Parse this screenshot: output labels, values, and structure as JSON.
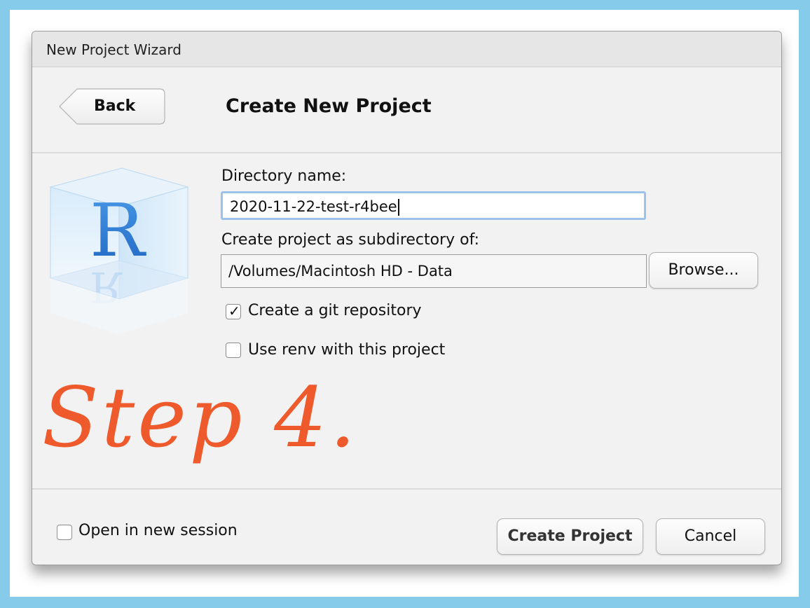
{
  "window": {
    "title": "New Project Wizard"
  },
  "header": {
    "back_label": "Back",
    "title": "Create New Project"
  },
  "form": {
    "directory_name_label": "Directory name:",
    "directory_name_value": "2020-11-22-test-r4bee",
    "parent_label": "Create project as subdirectory of:",
    "parent_value": "/Volumes/Macintosh HD - Data",
    "browse_label": "Browse...",
    "git_label": "Create a git repository",
    "git_checked": true,
    "renv_label": "Use renv with this project",
    "renv_checked": false
  },
  "annotation": {
    "text": "Step 4.",
    "color": "#EE5A2C"
  },
  "footer": {
    "new_session_label": "Open in new session",
    "new_session_checked": false,
    "create_label": "Create Project",
    "cancel_label": "Cancel"
  },
  "icons": {
    "logo": "r-logo-cube-icon",
    "back": "back-arrow-shape-icon",
    "check": "checkmark-icon"
  },
  "colors": {
    "background": "#87CBEA",
    "focus_ring": "#9ec3ea",
    "logo_blue": "#2e7bd6"
  }
}
